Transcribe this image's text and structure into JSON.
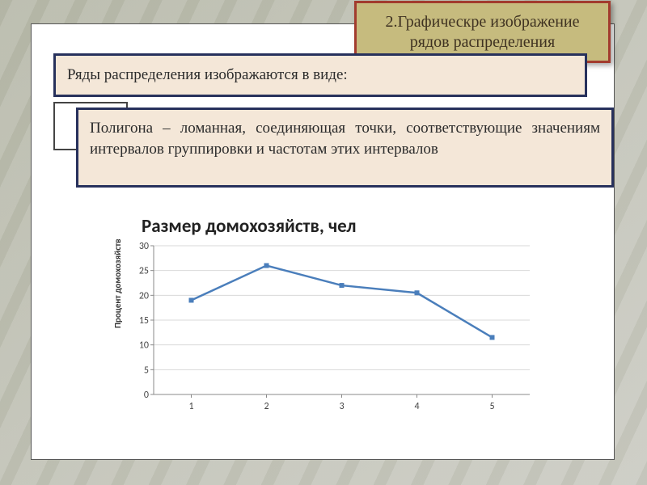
{
  "title": "2.Графическре изображение рядов распределения",
  "intro": "Ряды распределения изображаются в виде:",
  "polygon_def": "Полигона – ломанная, соединяющая точки, соответствующие значениям интервалов группировки и частотам этих интервалов",
  "chart_data": {
    "type": "line",
    "title": "Размер домохозяйств, чел",
    "xlabel": "",
    "ylabel": "Процент домохозяйств",
    "categories": [
      "1",
      "2",
      "3",
      "4",
      "5"
    ],
    "values": [
      19,
      26,
      22,
      20.5,
      11.5
    ],
    "ylim": [
      0,
      30
    ],
    "y_ticks": [
      0,
      5,
      10,
      15,
      20,
      25,
      30
    ],
    "grid": "horizontal",
    "line_color": "#4a7ebb"
  }
}
